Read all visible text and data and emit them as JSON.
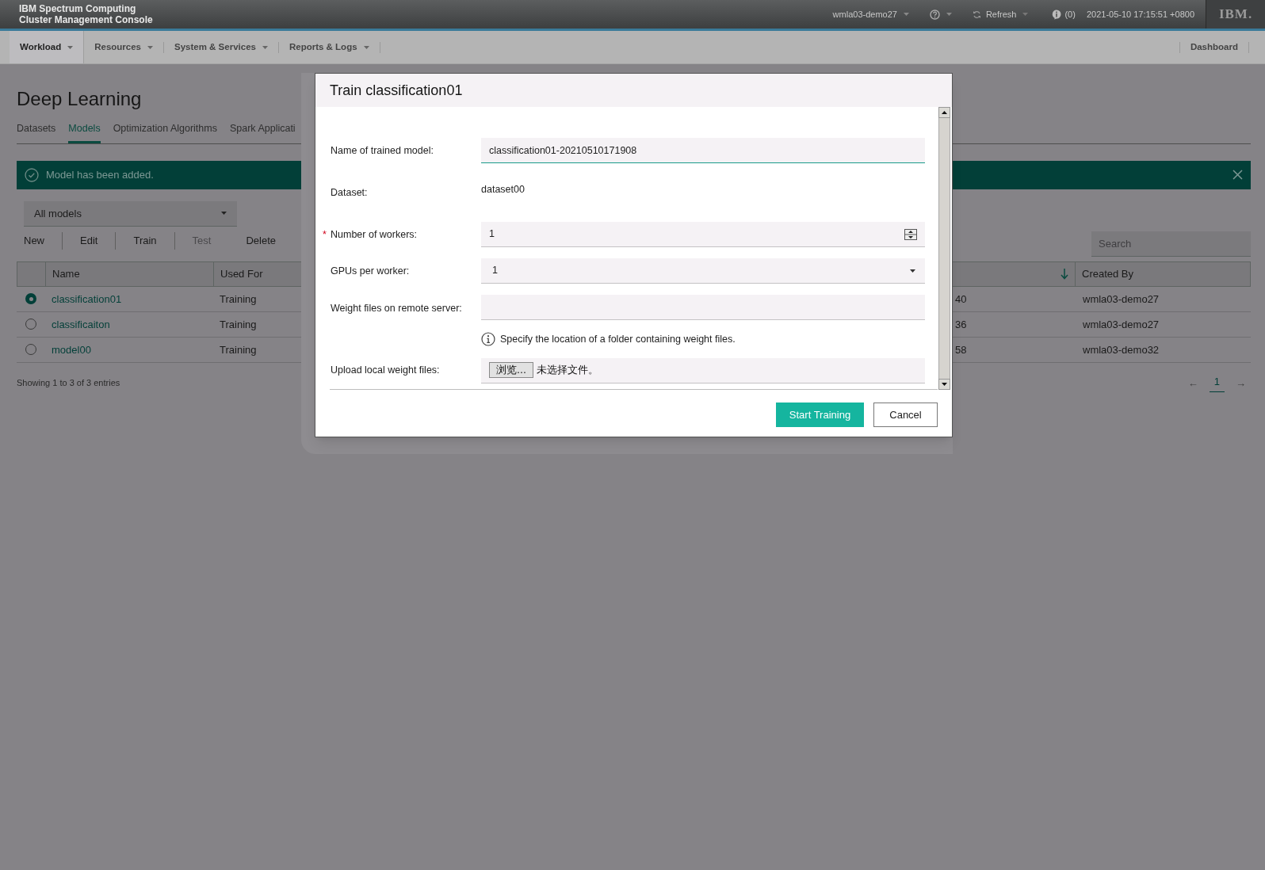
{
  "header": {
    "title_lines": [
      "IBM Spectrum Computing",
      "Cluster Management Console"
    ],
    "user": "wmla03-demo27",
    "refresh": "Refresh",
    "notifications": "(0)",
    "datetime": "2021-05-10 17:15:51 +0800",
    "logo": "IBM."
  },
  "nav": {
    "items": [
      {
        "label": "Workload",
        "selected": true
      },
      {
        "label": "Resources",
        "selected": false
      },
      {
        "label": "System & Services",
        "selected": false
      },
      {
        "label": "Reports & Logs",
        "selected": false
      }
    ],
    "right": "Dashboard"
  },
  "page": {
    "title": "Deep Learning",
    "tabs": [
      {
        "label": "Datasets",
        "selected": false
      },
      {
        "label": "Models",
        "selected": true
      },
      {
        "label": "Optimization Algorithms",
        "selected": false
      },
      {
        "label": "Spark Applicati",
        "selected": false
      }
    ],
    "banner": {
      "message": "Model has been added."
    },
    "filter": {
      "value": "All models"
    },
    "toolbar": [
      {
        "label": "New",
        "disabled": false
      },
      {
        "label": "Edit",
        "disabled": false
      },
      {
        "label": "Train",
        "disabled": false
      },
      {
        "label": "Test",
        "disabled": true
      },
      {
        "label": "Delete",
        "disabled": false
      }
    ],
    "search": {
      "placeholder": "Search"
    },
    "table": {
      "columns": [
        {
          "label": "Name"
        },
        {
          "label": "Used For"
        },
        {
          "sorted": true
        },
        {
          "label": "Created By"
        }
      ],
      "rows": [
        {
          "selected": true,
          "name": "classification01",
          "used_for": "Training",
          "column_4": "40",
          "created_by": "wmla03-demo27"
        },
        {
          "selected": false,
          "name": "classificaiton",
          "used_for": "Training",
          "column_4": "36",
          "created_by": "wmla03-demo27"
        },
        {
          "selected": false,
          "name": "model00",
          "used_for": "Training",
          "column_4": "58",
          "created_by": "wmla03-demo32"
        }
      ]
    },
    "footer": "Showing 1 to 3 of 3 entries",
    "pagination": {
      "prev": "←",
      "page": "1",
      "next": "→"
    }
  },
  "modal": {
    "title": "Train classification01",
    "required_mark": "*",
    "fields": [
      {
        "kind": "text",
        "label": "Name of trained model:",
        "value": "classification01-20210510171908",
        "required": false,
        "focused": true
      },
      {
        "kind": "static",
        "label": "Dataset:",
        "value": "dataset00",
        "required": false
      },
      {
        "kind": "number",
        "label": "Number of workers:",
        "value": "1",
        "required": true
      },
      {
        "kind": "select",
        "label": "GPUs per worker:",
        "value": "1",
        "required": false
      },
      {
        "kind": "text",
        "label": "Weight files on remote server:",
        "required": false,
        "focused": false,
        "hint": "Specify the location of a folder containing weight files."
      },
      {
        "kind": "file",
        "label": "Upload local weight files:",
        "button": "浏览...",
        "status": "未选择文件。",
        "required": false
      }
    ],
    "buttons": [
      {
        "label": "Start Training",
        "kind": "primary"
      },
      {
        "label": "Cancel",
        "kind": "secondary"
      }
    ]
  }
}
